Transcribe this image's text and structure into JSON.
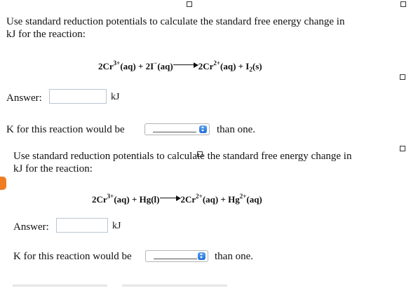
{
  "q1": {
    "prompt_line1": "Use standard reduction potentials to calculate the standard free energy change in",
    "prompt_line2": "kJ for the reaction:",
    "eq": {
      "left_coef1": "2Cr",
      "left_charge1": "3+",
      "left_state1": "(aq) + 2I",
      "left_charge2": "−",
      "left_state2": "(aq)",
      "right_coef1": "2Cr",
      "right_charge1": "2+",
      "right_state1": "(aq) + I",
      "right_sub": "2",
      "right_state2": "(s)"
    },
    "answer_label": "Answer:",
    "answer_value": "",
    "answer_unit": "kJ",
    "k_label": "K for this reaction would be",
    "k_selected": "",
    "k_suffix": "than one."
  },
  "q2": {
    "prompt_line1": "Use standard reduction potentials to calculate the standard free energy change in",
    "prompt_line2": "kJ for the reaction:",
    "eq": {
      "left_coef1": "2Cr",
      "left_charge1": "3+",
      "left_state1": "(aq) + Hg(l)",
      "right_coef1": "2Cr",
      "right_charge1": "2+",
      "right_state1": "(aq) + Hg",
      "right_charge2": "2+",
      "right_state2": "(aq)"
    },
    "answer_label": "Answer:",
    "answer_value": "",
    "answer_unit": "kJ",
    "k_label": "K for this reaction would be",
    "k_selected": "",
    "k_suffix": "than one."
  },
  "icons": [
    "square-marker-icon",
    "stepper-icon",
    "arrow-icon",
    "orange-tab-icon"
  ],
  "colors": {
    "stepper_blue": "#2f80e0",
    "orange_tab": "#f07d24",
    "input_border": "#b9c6d4"
  }
}
